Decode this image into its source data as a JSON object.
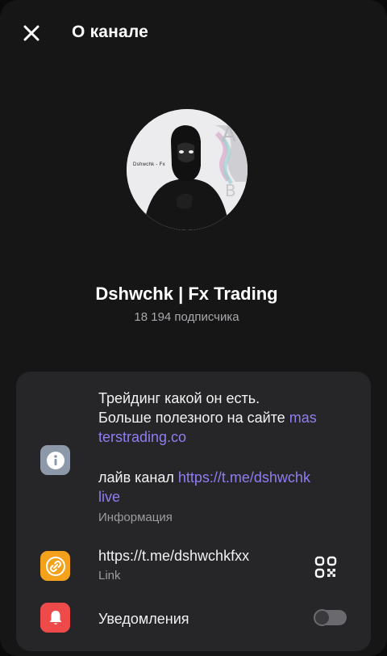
{
  "header": {
    "title": "О канале"
  },
  "channel": {
    "avatar_label": "Dshwchk - Fx",
    "name": "Dshwchk | Fx Trading",
    "subscribers": "18 194 подписчика"
  },
  "info": {
    "line1": "Трейдинг какой он есть.",
    "line2_text": "Больше полезного на сайте ",
    "line2_link": "mas",
    "line3_link": "terstrading.co",
    "line4_text": "лайв канал ",
    "line4_link": "https://t.me/dshwchk",
    "line5_link": "live",
    "caption": "Информация"
  },
  "link": {
    "url": "https://t.me/dshwchkfxx",
    "caption": "Link"
  },
  "notifications": {
    "label": "Уведомления",
    "enabled": false
  },
  "colors": {
    "accent_link": "#8e7ef0",
    "info_icon_bg": "#8d98a8",
    "link_icon_bg": "#f4a11c",
    "bell_icon_bg": "#ef4a4a"
  }
}
